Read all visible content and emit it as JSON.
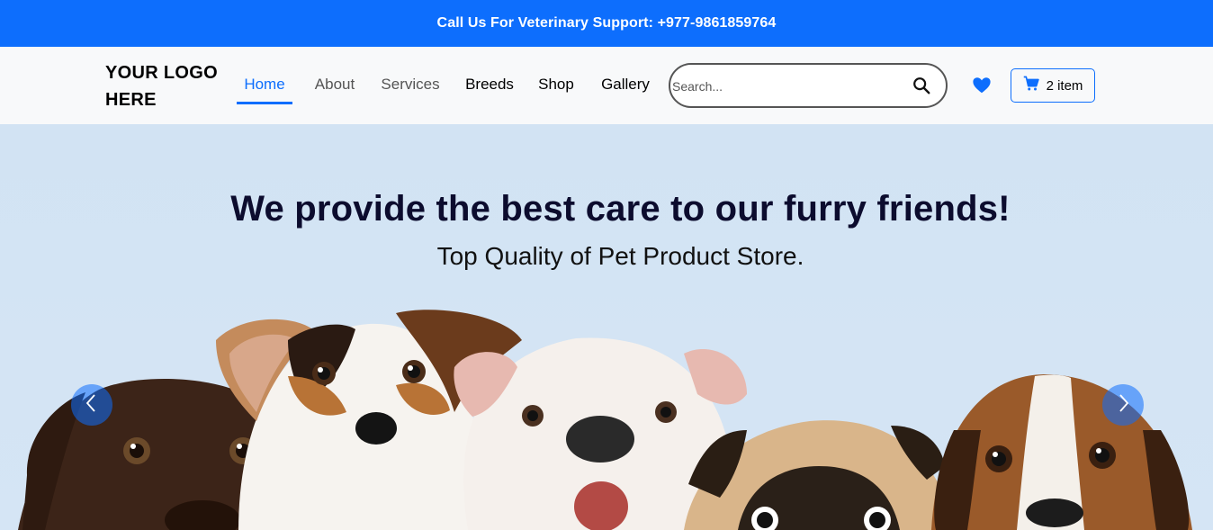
{
  "topbar": {
    "support_text": "Call Us For Veterinary Support: +977-9861859764"
  },
  "header": {
    "logo_line1": "YOUR LOGO",
    "logo_line2": "HERE",
    "nav": [
      {
        "label": "Home",
        "active": true
      },
      {
        "label": "About"
      },
      {
        "label": "Services"
      },
      {
        "label": "Breeds"
      },
      {
        "label": "Shop"
      },
      {
        "label": "Gallery"
      }
    ],
    "search": {
      "placeholder": "Search...",
      "value": ""
    },
    "icons": {
      "search": "search-icon",
      "wishlist": "heart-icon",
      "cart": "cart-icon"
    },
    "cart_label": "2 item"
  },
  "hero": {
    "title": "We provide the best care to our furry friends!",
    "subtitle": "Top Quality of Pet Product Store.",
    "image": "group of puppies",
    "prev_icon": "chevron-left-icon",
    "next_icon": "chevron-right-icon"
  },
  "colors": {
    "primary": "#0d6efd",
    "navbar_bg": "#f8f9fa",
    "hero_bg": "#d3e4f4",
    "title_color": "#0c0c2e"
  }
}
